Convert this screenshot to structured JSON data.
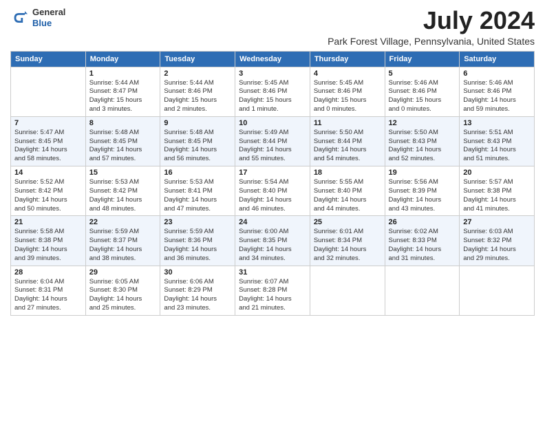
{
  "logo": {
    "general": "General",
    "blue": "Blue"
  },
  "header": {
    "month": "July 2024",
    "location": "Park Forest Village, Pennsylvania, United States"
  },
  "weekdays": [
    "Sunday",
    "Monday",
    "Tuesday",
    "Wednesday",
    "Thursday",
    "Friday",
    "Saturday"
  ],
  "weeks": [
    [
      {
        "day": "",
        "info": ""
      },
      {
        "day": "1",
        "info": "Sunrise: 5:44 AM\nSunset: 8:47 PM\nDaylight: 15 hours\nand 3 minutes."
      },
      {
        "day": "2",
        "info": "Sunrise: 5:44 AM\nSunset: 8:46 PM\nDaylight: 15 hours\nand 2 minutes."
      },
      {
        "day": "3",
        "info": "Sunrise: 5:45 AM\nSunset: 8:46 PM\nDaylight: 15 hours\nand 1 minute."
      },
      {
        "day": "4",
        "info": "Sunrise: 5:45 AM\nSunset: 8:46 PM\nDaylight: 15 hours\nand 0 minutes."
      },
      {
        "day": "5",
        "info": "Sunrise: 5:46 AM\nSunset: 8:46 PM\nDaylight: 15 hours\nand 0 minutes."
      },
      {
        "day": "6",
        "info": "Sunrise: 5:46 AM\nSunset: 8:46 PM\nDaylight: 14 hours\nand 59 minutes."
      }
    ],
    [
      {
        "day": "7",
        "info": "Sunrise: 5:47 AM\nSunset: 8:45 PM\nDaylight: 14 hours\nand 58 minutes."
      },
      {
        "day": "8",
        "info": "Sunrise: 5:48 AM\nSunset: 8:45 PM\nDaylight: 14 hours\nand 57 minutes."
      },
      {
        "day": "9",
        "info": "Sunrise: 5:48 AM\nSunset: 8:45 PM\nDaylight: 14 hours\nand 56 minutes."
      },
      {
        "day": "10",
        "info": "Sunrise: 5:49 AM\nSunset: 8:44 PM\nDaylight: 14 hours\nand 55 minutes."
      },
      {
        "day": "11",
        "info": "Sunrise: 5:50 AM\nSunset: 8:44 PM\nDaylight: 14 hours\nand 54 minutes."
      },
      {
        "day": "12",
        "info": "Sunrise: 5:50 AM\nSunset: 8:43 PM\nDaylight: 14 hours\nand 52 minutes."
      },
      {
        "day": "13",
        "info": "Sunrise: 5:51 AM\nSunset: 8:43 PM\nDaylight: 14 hours\nand 51 minutes."
      }
    ],
    [
      {
        "day": "14",
        "info": "Sunrise: 5:52 AM\nSunset: 8:42 PM\nDaylight: 14 hours\nand 50 minutes."
      },
      {
        "day": "15",
        "info": "Sunrise: 5:53 AM\nSunset: 8:42 PM\nDaylight: 14 hours\nand 48 minutes."
      },
      {
        "day": "16",
        "info": "Sunrise: 5:53 AM\nSunset: 8:41 PM\nDaylight: 14 hours\nand 47 minutes."
      },
      {
        "day": "17",
        "info": "Sunrise: 5:54 AM\nSunset: 8:40 PM\nDaylight: 14 hours\nand 46 minutes."
      },
      {
        "day": "18",
        "info": "Sunrise: 5:55 AM\nSunset: 8:40 PM\nDaylight: 14 hours\nand 44 minutes."
      },
      {
        "day": "19",
        "info": "Sunrise: 5:56 AM\nSunset: 8:39 PM\nDaylight: 14 hours\nand 43 minutes."
      },
      {
        "day": "20",
        "info": "Sunrise: 5:57 AM\nSunset: 8:38 PM\nDaylight: 14 hours\nand 41 minutes."
      }
    ],
    [
      {
        "day": "21",
        "info": "Sunrise: 5:58 AM\nSunset: 8:38 PM\nDaylight: 14 hours\nand 39 minutes."
      },
      {
        "day": "22",
        "info": "Sunrise: 5:59 AM\nSunset: 8:37 PM\nDaylight: 14 hours\nand 38 minutes."
      },
      {
        "day": "23",
        "info": "Sunrise: 5:59 AM\nSunset: 8:36 PM\nDaylight: 14 hours\nand 36 minutes."
      },
      {
        "day": "24",
        "info": "Sunrise: 6:00 AM\nSunset: 8:35 PM\nDaylight: 14 hours\nand 34 minutes."
      },
      {
        "day": "25",
        "info": "Sunrise: 6:01 AM\nSunset: 8:34 PM\nDaylight: 14 hours\nand 32 minutes."
      },
      {
        "day": "26",
        "info": "Sunrise: 6:02 AM\nSunset: 8:33 PM\nDaylight: 14 hours\nand 31 minutes."
      },
      {
        "day": "27",
        "info": "Sunrise: 6:03 AM\nSunset: 8:32 PM\nDaylight: 14 hours\nand 29 minutes."
      }
    ],
    [
      {
        "day": "28",
        "info": "Sunrise: 6:04 AM\nSunset: 8:31 PM\nDaylight: 14 hours\nand 27 minutes."
      },
      {
        "day": "29",
        "info": "Sunrise: 6:05 AM\nSunset: 8:30 PM\nDaylight: 14 hours\nand 25 minutes."
      },
      {
        "day": "30",
        "info": "Sunrise: 6:06 AM\nSunset: 8:29 PM\nDaylight: 14 hours\nand 23 minutes."
      },
      {
        "day": "31",
        "info": "Sunrise: 6:07 AM\nSunset: 8:28 PM\nDaylight: 14 hours\nand 21 minutes."
      },
      {
        "day": "",
        "info": ""
      },
      {
        "day": "",
        "info": ""
      },
      {
        "day": "",
        "info": ""
      }
    ]
  ]
}
